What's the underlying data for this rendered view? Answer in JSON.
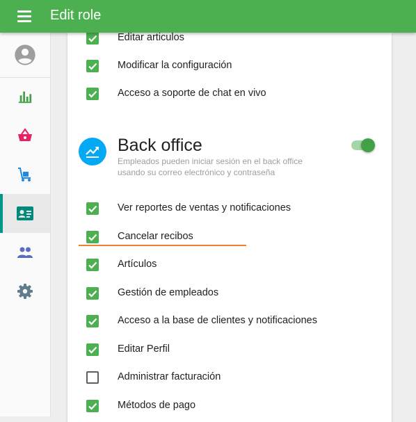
{
  "appbar": {
    "title": "Edit role"
  },
  "sidebar": {
    "items": [
      {
        "name": "avatar",
        "icon": "account-circle-icon"
      },
      {
        "name": "reports",
        "icon": "bar-chart-icon"
      },
      {
        "name": "sales",
        "icon": "basket-icon"
      },
      {
        "name": "inventory",
        "icon": "dolly-icon"
      },
      {
        "name": "employees",
        "icon": "badge-icon",
        "active": true
      },
      {
        "name": "customers",
        "icon": "people-icon"
      },
      {
        "name": "settings",
        "icon": "gear-icon"
      }
    ]
  },
  "pos_permissions": [
    {
      "label": "Editar articulos",
      "checked": true
    },
    {
      "label": "Modificar la configuración",
      "checked": true
    },
    {
      "label": "Acceso a soporte de chat en vivo",
      "checked": true
    }
  ],
  "back_office": {
    "title": "Back office",
    "description": "Empleados pueden iniciar sesión en el back office usando su correo electrónico y contraseña",
    "enabled": true
  },
  "back_office_permissions": [
    {
      "label": "Ver reportes de ventas y notificaciones",
      "checked": true
    },
    {
      "label": "Cancelar recibos",
      "checked": true
    },
    {
      "label": "Artículos",
      "checked": true
    },
    {
      "label": "Gestión de empleados",
      "checked": true
    },
    {
      "label": "Acceso a la base de clientes y notificaciones",
      "checked": true
    },
    {
      "label": "Editar Perfil",
      "checked": true
    },
    {
      "label": "Administrar facturación",
      "checked": false
    },
    {
      "label": "Métodos de pago",
      "checked": true
    }
  ],
  "colors": {
    "primary": "#4caf50",
    "active_indicator": "#009688",
    "section_icon": "#03a9f4",
    "highlight": "#ef7f30"
  }
}
